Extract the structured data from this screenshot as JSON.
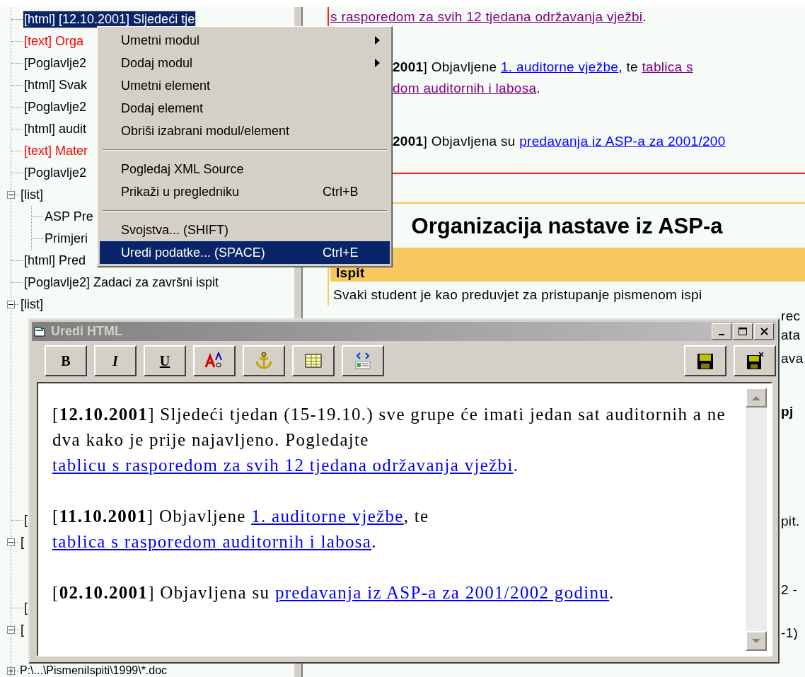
{
  "tree": {
    "items": [
      {
        "label": "[html] [12.10.2001] Sljedeći tje",
        "selected": true
      },
      {
        "label": "[text] Orga",
        "color": "#ff0000",
        "selected": false
      },
      {
        "label": "[Poglavlje2",
        "color": "#000000",
        "selected": false
      },
      {
        "label": "[html] Svak",
        "color": "#000000",
        "selected": false
      },
      {
        "label": "[Poglavlje2",
        "color": "#000000",
        "selected": false
      },
      {
        "label": "[html] audit",
        "color": "#000000",
        "selected": false
      },
      {
        "label": "[text] Mater",
        "color": "#ff0000",
        "selected": false
      },
      {
        "label": "[Poglavlje2",
        "color": "#000000",
        "selected": false
      },
      {
        "label": "[list]",
        "color": "#000000",
        "selected": false,
        "expanded": true,
        "children": [
          {
            "label": "ASP Pre",
            "color": "#000000",
            "selected": false
          },
          {
            "label": "Primjeri",
            "color": "#000000",
            "selected": false
          }
        ]
      },
      {
        "label": "[html] Pred",
        "color": "#000000",
        "selected": false
      },
      {
        "label": "[Poglavlje2] Zadaci za završni ispit",
        "color": "#000000",
        "selected": false
      },
      {
        "label": "[list]",
        "color": "#000000",
        "selected": false,
        "expanded": true
      },
      {
        "label": "[",
        "color": "#000000",
        "selected": false
      },
      {
        "label": "[",
        "color": "#000000",
        "selected": false,
        "expanded": true
      },
      {
        "label": "[",
        "color": "#000000",
        "selected": false
      },
      {
        "label": "[",
        "color": "#000000",
        "selected": false,
        "expanded": true
      },
      {
        "label": "P:\\...\\PismeniIspiti\\1999\\*.doc",
        "color": "#000000",
        "selected": false,
        "expanded": false
      }
    ]
  },
  "browser": {
    "news": [
      [
        {
          "kind": "link",
          "text": "s rasporedom za svih 12 tjedana održavanja vježbi",
          "visited": true
        },
        {
          "kind": "text",
          "text": "."
        }
      ],
      [
        {
          "kind": "bold",
          "text": "2001"
        },
        {
          "kind": "text",
          "text": "] Objavljene "
        },
        {
          "kind": "link",
          "text": "1. auditorne vježbe",
          "visited": false
        },
        {
          "kind": "text",
          "text": ", te "
        },
        {
          "kind": "link",
          "text": "tablica s",
          "visited": true
        }
      ],
      [
        {
          "kind": "link",
          "text": "dom auditornih i labosa",
          "visited": true
        },
        {
          "kind": "text",
          "text": "."
        }
      ],
      [
        {
          "kind": "bold",
          "text": "2001"
        },
        {
          "kind": "text",
          "text": "] Objavljena su "
        },
        {
          "kind": "link",
          "text": "predavanja iz ASP-a za 2001/200",
          "visited": false
        }
      ]
    ],
    "heading": "Organizacija nastave iz ASP-a",
    "band": "Ispit",
    "paragraph": "Svaki student je kao preduvjet za pristupanje pismenom ispi",
    "fragments": [
      {
        "text": "rec",
        "bold": false
      },
      {
        "text": "ata",
        "bold": false
      },
      {
        "text": "ava",
        "bold": false
      },
      {
        "text": "pj",
        "bold": true
      },
      {
        "text": "pit.",
        "bold": false
      },
      {
        "text": "2 -",
        "bold": false
      },
      {
        "text": "-1)",
        "bold": false
      }
    ]
  },
  "context_menu": {
    "items": [
      {
        "kind": "item",
        "label": "Umetni modul",
        "submenu": true,
        "selected": false
      },
      {
        "kind": "item",
        "label": "Dodaj modul",
        "submenu": true,
        "selected": false
      },
      {
        "kind": "item",
        "label": "Umetni element",
        "submenu": false,
        "selected": false
      },
      {
        "kind": "item",
        "label": "Dodaj element",
        "submenu": false,
        "selected": false
      },
      {
        "kind": "item",
        "label": "Obriši izabrani modul/element",
        "submenu": false,
        "selected": false
      },
      {
        "kind": "separator"
      },
      {
        "kind": "item",
        "label": "Pogledaj XML Source",
        "submenu": false,
        "selected": false
      },
      {
        "kind": "item",
        "label": "Prikaži u pregledniku",
        "shortcut": "Ctrl+B",
        "submenu": false,
        "selected": false
      },
      {
        "kind": "separator"
      },
      {
        "kind": "item",
        "label": "Svojstva... (SHIFT)",
        "submenu": false,
        "selected": false
      },
      {
        "kind": "item",
        "label": "Uredi podatke... (SPACE)",
        "shortcut": "Ctrl+E",
        "submenu": false,
        "selected": true
      }
    ]
  },
  "dialog": {
    "title": "Uredi HTML",
    "toolbar": [
      {
        "kind": "bold",
        "label": "B"
      },
      {
        "kind": "italic",
        "label": "I"
      },
      {
        "kind": "underline",
        "label": "U"
      },
      {
        "kind": "font"
      },
      {
        "kind": "anchor"
      },
      {
        "kind": "table"
      },
      {
        "kind": "source"
      },
      {
        "kind": "spacer"
      },
      {
        "kind": "save"
      },
      {
        "kind": "save-close"
      }
    ],
    "paragraphs": [
      [
        {
          "kind": "text",
          "text": "[**12.10.2001**] Sljedeći tjedan (15-19.10.) sve grupe će imati jedan sat auditornih a ne dva kako je prije najavljeno. Pogledajte "
        },
        {
          "kind": "link",
          "text": "tablicu s rasporedom za svih 12 tjedana održavanja vježbi"
        },
        {
          "kind": "text",
          "text": "."
        }
      ],
      [
        {
          "kind": "text",
          "text": "[**11.10.2001**] Objavljene "
        },
        {
          "kind": "link",
          "text": "1. auditorne vježbe"
        },
        {
          "kind": "text",
          "text": ", te "
        },
        {
          "kind": "link",
          "text": "tablica s rasporedom auditornih i labosa"
        },
        {
          "kind": "text",
          "text": "."
        }
      ],
      [
        {
          "kind": "text",
          "text": "[**02.10.2001**] Objavljena su "
        },
        {
          "kind": "link",
          "text": "predavanja iz ASP-a za 2001/2002 godinu"
        },
        {
          "kind": "text",
          "text": "."
        }
      ]
    ]
  }
}
